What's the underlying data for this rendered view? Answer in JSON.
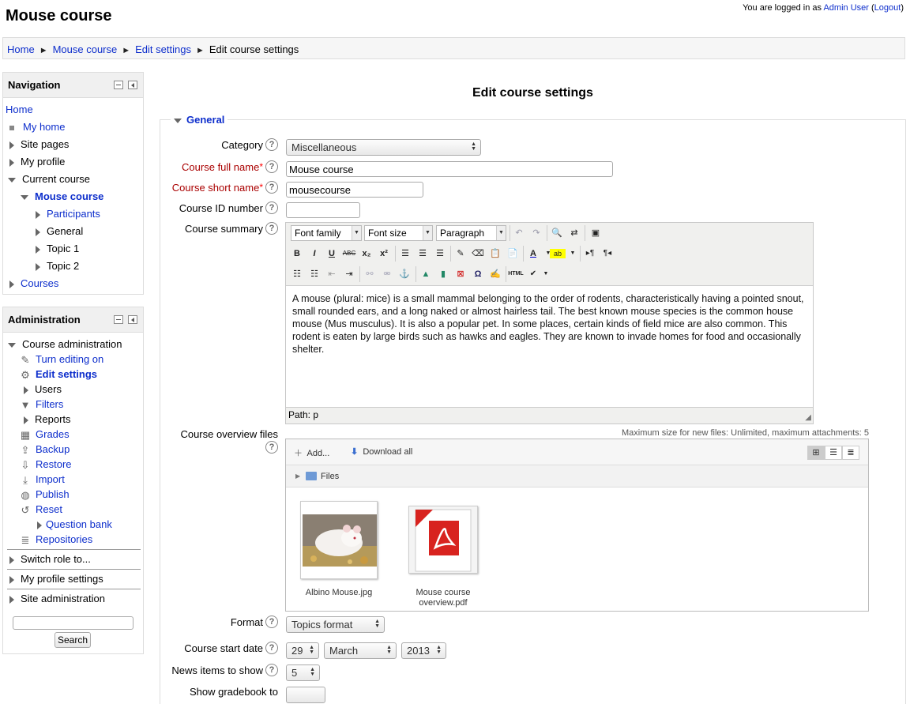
{
  "header": {
    "site_title": "Mouse course",
    "logged_in_prefix": "You are logged in as",
    "user_name": "Admin User",
    "logout_label": "Logout"
  },
  "breadcrumb": {
    "items": [
      "Home",
      "Mouse course",
      "Edit settings",
      "Edit course settings"
    ],
    "separator": "►"
  },
  "navigation": {
    "title": "Navigation",
    "home": "Home",
    "my_home": "My home",
    "site_pages": "Site pages",
    "my_profile": "My profile",
    "current_course": "Current course",
    "course_name": "Mouse course",
    "participants": "Participants",
    "general": "General",
    "topic1": "Topic 1",
    "topic2": "Topic 2",
    "courses": "Courses"
  },
  "administration": {
    "title": "Administration",
    "course_admin": "Course administration",
    "items": [
      "Turn editing on",
      "Edit settings",
      "Users",
      "Filters",
      "Reports",
      "Grades",
      "Backup",
      "Restore",
      "Import",
      "Publish",
      "Reset",
      "Question bank",
      "Repositories"
    ],
    "switch_role": "Switch role to...",
    "my_profile_settings": "My profile settings",
    "site_admin": "Site administration",
    "search_button": "Search"
  },
  "form": {
    "heading": "Edit course settings",
    "section": "General",
    "category_label": "Category",
    "category_value": "Miscellaneous",
    "fullname_label": "Course full name",
    "fullname_value": "Mouse course",
    "shortname_label": "Course short name",
    "shortname_value": "mousecourse",
    "idnumber_label": "Course ID number",
    "idnumber_value": "",
    "summary_label": "Course summary",
    "summary_text": "A mouse (plural: mice) is a small mammal belonging to the order of rodents, characteristically having a pointed snout, small rounded ears, and a long naked or almost hairless tail. The best known mouse species is the common house mouse (Mus musculus). It is also a popular pet. In some places, certain kinds of field mice are also common. This rodent is eaten by large birds such as hawks and eagles. They are known to invade homes for food and occasionally shelter.",
    "editor_path": "Path: p",
    "overview_label": "Course overview files",
    "format_label": "Format",
    "format_value": "Topics format",
    "startdate_label": "Course start date",
    "start_day": "29",
    "start_month": "March",
    "start_year": "2013",
    "news_label": "News items to show",
    "news_value": "5",
    "gradebook_label": "Show gradebook to"
  },
  "editor_toolbar": {
    "font_family": "Font family",
    "font_size": "Font size",
    "paragraph": "Paragraph"
  },
  "filemanager": {
    "limits": "Maximum size for new files: Unlimited, maximum attachments: 5",
    "add": "Add...",
    "download_all": "Download all",
    "folder": "Files",
    "files": [
      {
        "name": "Albino Mouse.jpg"
      },
      {
        "name_line1": "Mouse course",
        "name_line2": "overview.pdf"
      }
    ]
  },
  "colors": {
    "link": "#0d2ecc",
    "required": "#aa0000"
  }
}
